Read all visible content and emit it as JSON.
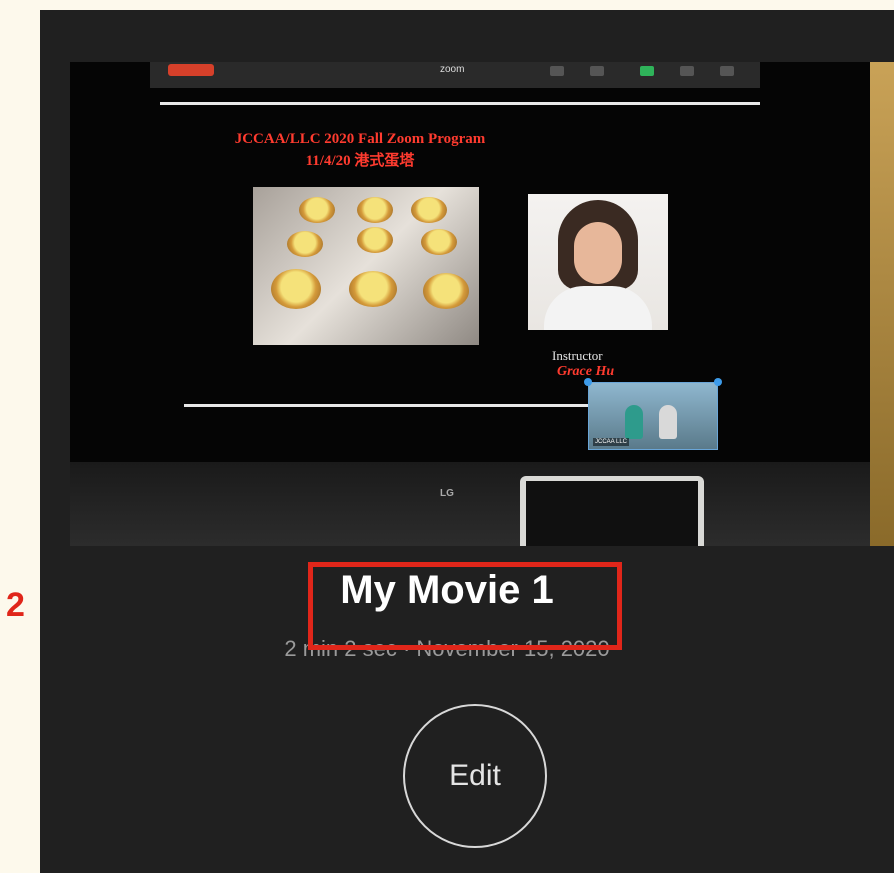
{
  "thumbnail": {
    "zoom_menu_label": "zoom",
    "slide_title_line1": "JCCAA/LLC 2020 Fall Zoom Program",
    "slide_title_line2": "11/4/20 港式蛋塔",
    "instructor_label": "Instructor",
    "instructor_name": "Grace Hu",
    "pip_label": "JCCAA LLC",
    "tv_brand": "LG"
  },
  "movie": {
    "title": "My Movie 1",
    "meta": "2 min 2 sec · November 15, 2020"
  },
  "actions": {
    "edit_label": "Edit"
  },
  "annotation": {
    "step_number": "2",
    "highlight_color": "#e0261a"
  },
  "colors": {
    "background": "#202020",
    "page_margin": "#fdf9ec",
    "slide_title": "#ff3b2f"
  }
}
